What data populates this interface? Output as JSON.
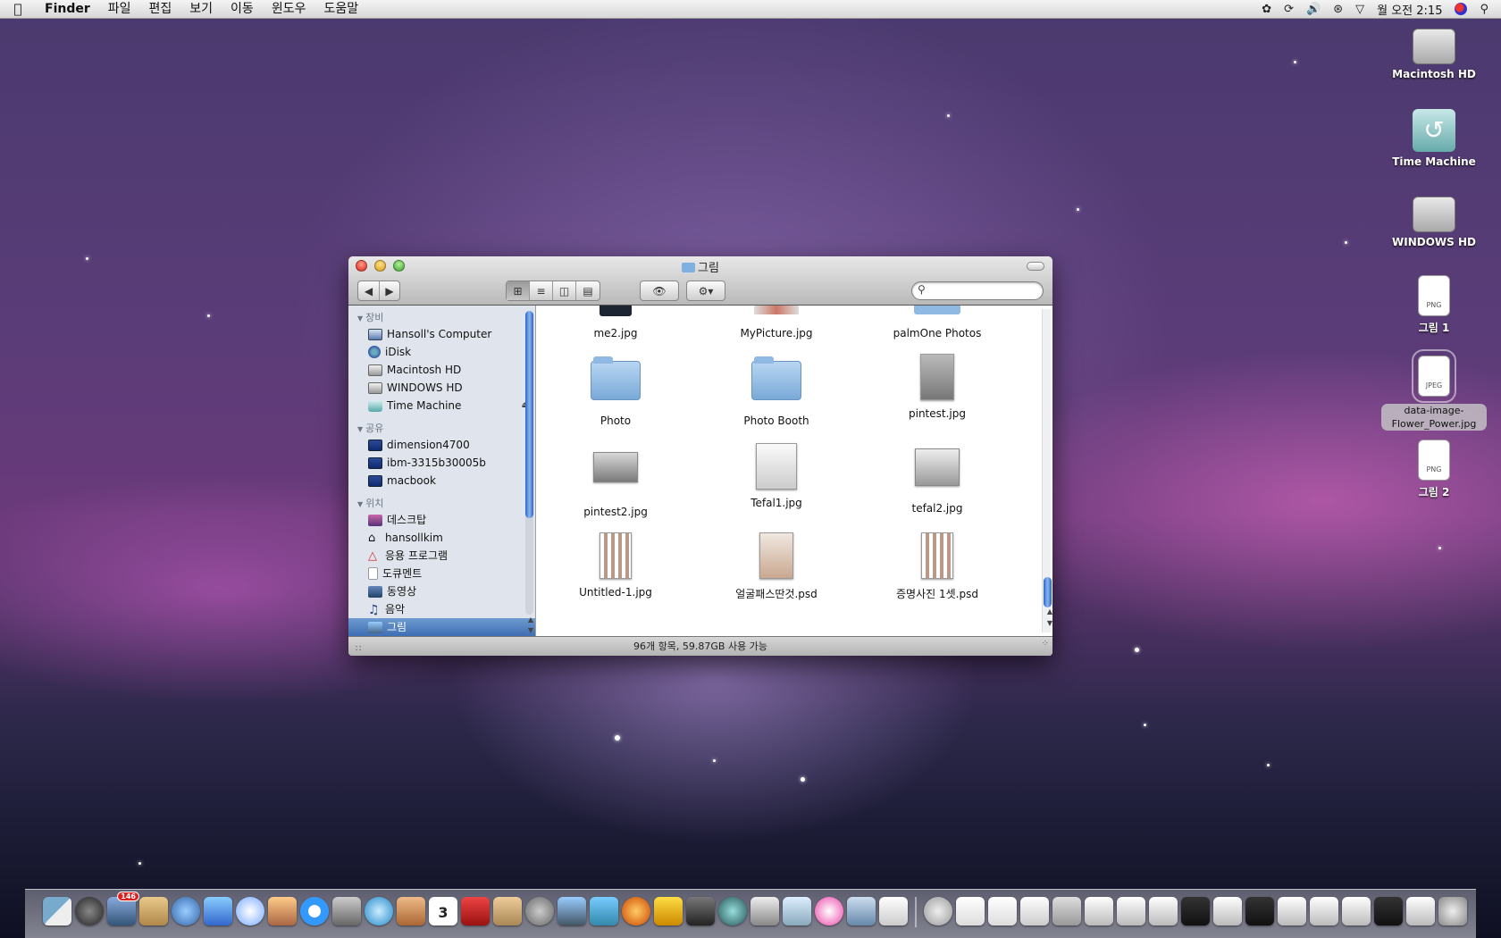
{
  "menubar": {
    "app_name": "Finder",
    "menus": [
      "파일",
      "편집",
      "보기",
      "이동",
      "윈도우",
      "도움말"
    ],
    "clock": "월 오전 2:15"
  },
  "desktop": {
    "icons": [
      {
        "label": "Macintosh HD",
        "kind": "drive"
      },
      {
        "label": "Time Machine",
        "kind": "time-machine"
      },
      {
        "label": "WINDOWS HD",
        "kind": "drive"
      },
      {
        "label": "그림 1",
        "kind": "png",
        "badge": "PNG"
      },
      {
        "label": "data-image-Flower_Power.jpg",
        "kind": "jpeg",
        "badge": "JPEG",
        "selected": true
      },
      {
        "label": "그림 2",
        "kind": "png",
        "badge": "PNG"
      }
    ]
  },
  "window": {
    "title": "그림",
    "search": {
      "value": "",
      "placeholder": ""
    },
    "status": "96개 항목, 59.87GB 사용 가능",
    "sidebar": {
      "sections": [
        {
          "title": "장비",
          "items": [
            {
              "label": "Hansoll's Computer",
              "icon": "computer-icon"
            },
            {
              "label": "iDisk",
              "icon": "idisk-icon"
            },
            {
              "label": "Macintosh HD",
              "icon": "hard-drive-icon"
            },
            {
              "label": "WINDOWS HD",
              "icon": "hard-drive-icon"
            },
            {
              "label": "Time Machine",
              "icon": "time-machine-icon",
              "eject": true
            }
          ]
        },
        {
          "title": "공유",
          "items": [
            {
              "label": "dimension4700",
              "icon": "network-computer-icon"
            },
            {
              "label": "ibm-3315b30005b",
              "icon": "network-computer-icon"
            },
            {
              "label": "macbook",
              "icon": "network-computer-icon"
            }
          ]
        },
        {
          "title": "위치",
          "items": [
            {
              "label": "데스크탑",
              "icon": "desktop-icon"
            },
            {
              "label": "hansollkim",
              "icon": "home-icon"
            },
            {
              "label": "응용 프로그램",
              "icon": "applications-icon"
            },
            {
              "label": "도큐멘트",
              "icon": "documents-icon"
            },
            {
              "label": "동영상",
              "icon": "movies-icon"
            },
            {
              "label": "음악",
              "icon": "music-icon"
            },
            {
              "label": "그림",
              "icon": "pictures-icon",
              "selected": true
            }
          ]
        }
      ]
    },
    "files": [
      {
        "name": "me2.jpg",
        "kind": "partial-image"
      },
      {
        "name": "MyPicture.jpg",
        "kind": "partial-picture"
      },
      {
        "name": "palmOne Photos",
        "kind": "partial-folder"
      },
      {
        "name": "Photo",
        "kind": "folder"
      },
      {
        "name": "Photo Booth",
        "kind": "folder"
      },
      {
        "name": "pintest.jpg",
        "kind": "image"
      },
      {
        "name": "pintest2.jpg",
        "kind": "image"
      },
      {
        "name": "Tefal1.jpg",
        "kind": "image"
      },
      {
        "name": "tefal2.jpg",
        "kind": "image"
      },
      {
        "name": "Untitled-1.jpg",
        "kind": "sheet"
      },
      {
        "name": "얼굴패스딴것.psd",
        "kind": "portrait"
      },
      {
        "name": "증명사진 1셋.psd",
        "kind": "sheet"
      }
    ]
  },
  "dock": {
    "mail_badge": "146",
    "calendar_day": "3"
  }
}
